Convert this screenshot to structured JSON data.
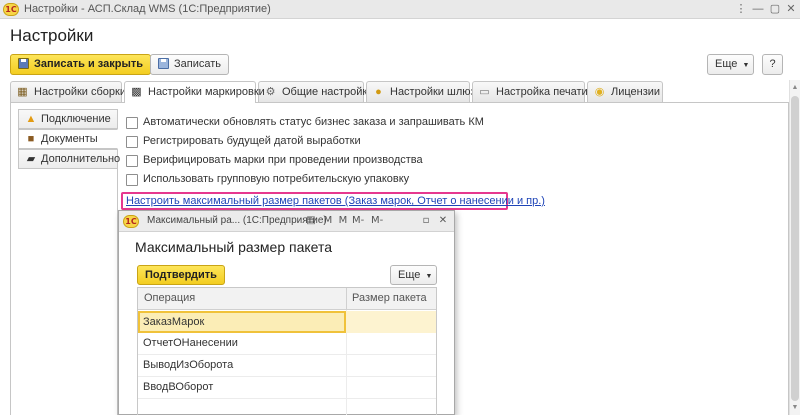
{
  "window": {
    "title": "Настройки - АСП.Склад WMS  (1С:Предприятие)",
    "logo_text": "1С",
    "controls": [
      "⋮",
      "—",
      "▢",
      "✕"
    ]
  },
  "page": {
    "title": "Настройки"
  },
  "toolbar": {
    "save_close_label": "Записать и закрыть",
    "save_label": "Записать",
    "more_label": "Еще",
    "help_label": "?"
  },
  "tabs": [
    {
      "label": "Настройки сборки",
      "icon": "table-icon",
      "active": false
    },
    {
      "label": "Настройки маркировки",
      "icon": "qr-code-icon",
      "active": true
    },
    {
      "label": "Общие настройки",
      "icon": "settings-icon",
      "active": false
    },
    {
      "label": "Настройки шлюз",
      "icon": "gateway-icon",
      "active": false
    },
    {
      "label": "Настройка печати",
      "icon": "printer-icon",
      "active": false
    },
    {
      "label": "Лицензии",
      "icon": "license-icon",
      "active": false
    }
  ],
  "sidebar": {
    "items": [
      {
        "label": "Подключение",
        "icon": "warning-icon",
        "active": false
      },
      {
        "label": "Документы",
        "icon": "briefcase-icon",
        "active": true
      },
      {
        "label": "Дополнительно",
        "icon": "chat-icon",
        "active": false
      }
    ]
  },
  "settings": {
    "checkboxes": [
      {
        "label": "Автоматически обновлять статус бизнес заказа и запрашивать КМ",
        "checked": false
      },
      {
        "label": "Регистрировать будущей датой выработки",
        "checked": false
      },
      {
        "label": "Верифицировать марки при проведении производства",
        "checked": false
      },
      {
        "label": "Использовать групповую потребительскую упаковку",
        "checked": false
      }
    ],
    "link_label": "Настроить максимальный размер пакетов (Заказ марок, Отчет о нанесении и пр.)",
    "highlight_color": "#e6388f"
  },
  "modal": {
    "title": "Максимальный ра... (1С:Предприятие)",
    "heading": "Максимальный размер пакета",
    "confirm_label": "Подтвердить",
    "more_label": "Еще",
    "title_icons": [
      "clipboard-icon",
      "memory-icon",
      "memory-plus-icon",
      "memory-minus-icon",
      "memory-m-icon",
      "restore-icon",
      "close-icon"
    ],
    "title_icon_glyphs": [
      "▤",
      "M",
      "M",
      "M-",
      "M-",
      "▫",
      "✕"
    ],
    "grid": {
      "columns": [
        "Операция",
        "Размер пакета"
      ],
      "rows": [
        {
          "operation": "ЗаказМарок",
          "size": "",
          "selected": true
        },
        {
          "operation": "ОтчетОНанесении",
          "size": "",
          "selected": false
        },
        {
          "operation": "ВыводИзОборота",
          "size": "",
          "selected": false
        },
        {
          "operation": "ВводВОборот",
          "size": "",
          "selected": false
        }
      ]
    }
  },
  "colors": {
    "primary_button": "#f3cd20",
    "link": "#1e44b7",
    "selected_row": "#fbedb6"
  }
}
